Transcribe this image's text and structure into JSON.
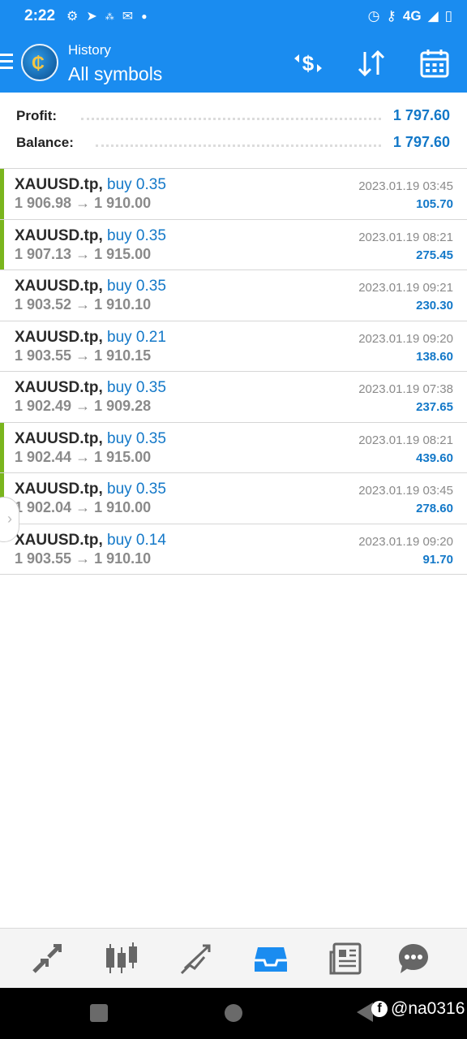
{
  "status_bar": {
    "time": "2:22",
    "network": "4G"
  },
  "app_bar": {
    "subtitle": "History",
    "title": "All symbols",
    "accent_color": "#1a8cf0"
  },
  "summary": {
    "profit_label": "Profit:",
    "profit_value": "1 797.60",
    "balance_label": "Balance:",
    "balance_value": "1 797.60"
  },
  "trades": [
    {
      "symbol": "XAUUSD.tp,",
      "side": "buy 0.35",
      "prices": "1 906.98 → 1 910.00",
      "datetime": "2023.01.19 03:45",
      "profit": "105.70",
      "highlight": true
    },
    {
      "symbol": "XAUUSD.tp,",
      "side": "buy 0.35",
      "prices": "1 907.13 → 1 915.00",
      "datetime": "2023.01.19 08:21",
      "profit": "275.45",
      "highlight": true
    },
    {
      "symbol": "XAUUSD.tp,",
      "side": "buy 0.35",
      "prices": "1 903.52 → 1 910.10",
      "datetime": "2023.01.19 09:21",
      "profit": "230.30",
      "highlight": false
    },
    {
      "symbol": "XAUUSD.tp,",
      "side": "buy 0.21",
      "prices": "1 903.55 → 1 910.15",
      "datetime": "2023.01.19 09:20",
      "profit": "138.60",
      "highlight": false
    },
    {
      "symbol": "XAUUSD.tp,",
      "side": "buy 0.35",
      "prices": "1 902.49 → 1 909.28",
      "datetime": "2023.01.19 07:38",
      "profit": "237.65",
      "highlight": false
    },
    {
      "symbol": "XAUUSD.tp,",
      "side": "buy 0.35",
      "prices": "1 902.44 → 1 915.00",
      "datetime": "2023.01.19 08:21",
      "profit": "439.60",
      "highlight": true
    },
    {
      "symbol": "XAUUSD.tp,",
      "side": "buy 0.35",
      "prices": "1 902.04 → 1 910.00",
      "datetime": "2023.01.19 03:45",
      "profit": "278.60",
      "highlight": true
    },
    {
      "symbol": "XAUUSD.tp,",
      "side": "buy 0.14",
      "prices": "1 903.55 → 1 910.10",
      "datetime": "2023.01.19 09:20",
      "profit": "91.70",
      "highlight": false
    }
  ],
  "tabs": [
    {
      "name": "quotes",
      "icon": "quotes-icon",
      "active": false
    },
    {
      "name": "chart",
      "icon": "candlestick-icon",
      "active": false
    },
    {
      "name": "trade",
      "icon": "trade-icon",
      "active": false
    },
    {
      "name": "history",
      "icon": "inbox-icon",
      "active": true
    },
    {
      "name": "news",
      "icon": "newspaper-icon",
      "active": false
    },
    {
      "name": "messages",
      "icon": "chat-icon",
      "active": false
    }
  ],
  "watermark": "@na0316"
}
